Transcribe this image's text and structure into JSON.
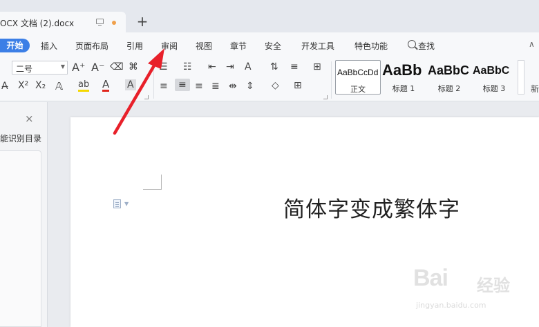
{
  "tab": {
    "title": "OCX 文档 (2).docx",
    "new_tab": "+"
  },
  "menu": {
    "active": "开始",
    "items": [
      "插入",
      "页面布局",
      "引用",
      "审阅",
      "视图",
      "章节",
      "安全",
      "开发工具",
      "特色功能"
    ],
    "search": "查找",
    "collapse": "∧"
  },
  "ribbon": {
    "font_size": "二号",
    "grow_font": "A⁺",
    "shrink_font": "A⁻",
    "superscript": "X²",
    "subscript": "X₂",
    "styles": [
      {
        "sample": "AaBbCcDd",
        "name": "正文"
      },
      {
        "sample": "AaBb",
        "name": "标题 1"
      },
      {
        "sample": "AaBbC",
        "name": "标题 2"
      },
      {
        "sample": "AaBbC",
        "name": "标题 3"
      }
    ],
    "new_style": "新"
  },
  "left_panel": {
    "close": "×",
    "text": "能识别目录"
  },
  "document": {
    "text": "简体字变成繁体字"
  },
  "watermark": {
    "logo": "Bai",
    "cn": "经验",
    "url": "jingyan.baidu.com"
  },
  "colors": {
    "accent": "#3c7fe6",
    "arrow": "#e8202a",
    "highlight": "#f5d800",
    "font_red": "#e0251b",
    "tab_dot": "#f0a04b"
  }
}
